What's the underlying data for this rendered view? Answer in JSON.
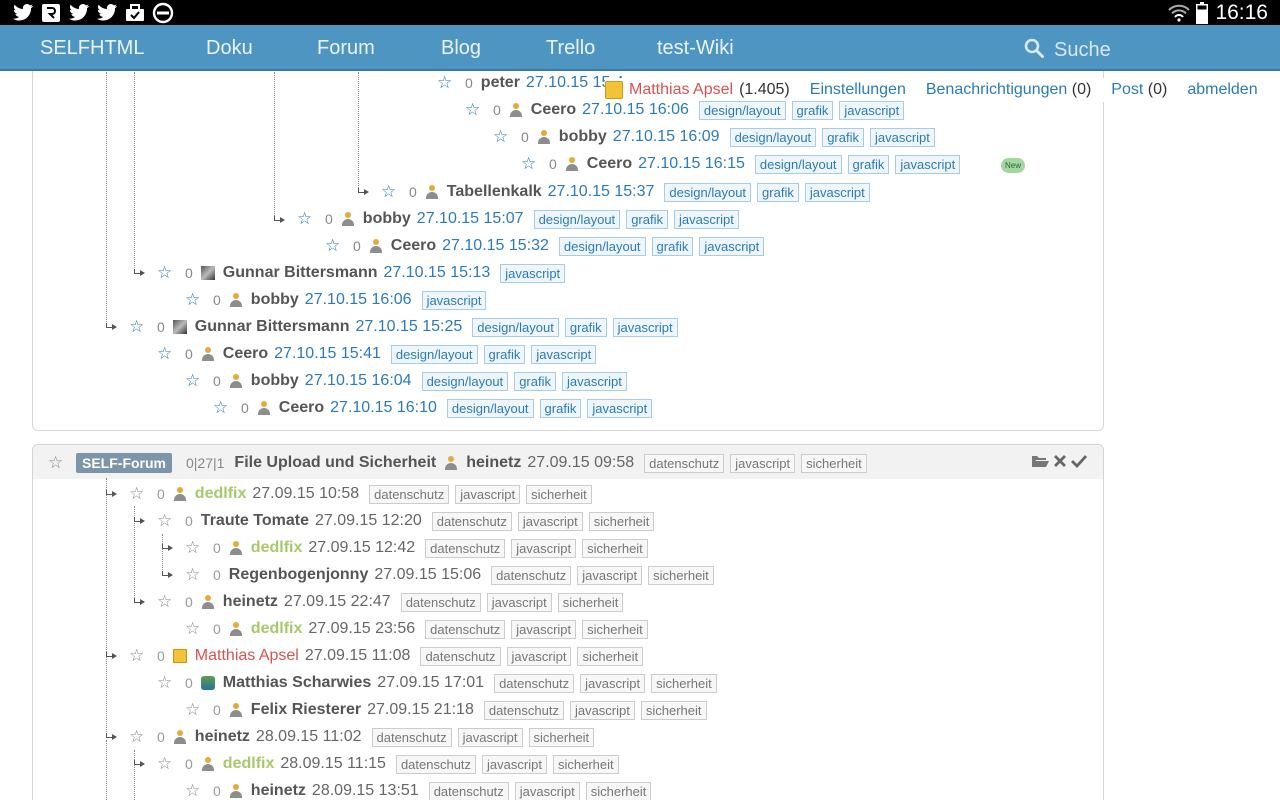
{
  "status_bar": {
    "left_icons": [
      "twitter-icon",
      "app-icon",
      "twitter-icon",
      "twitter-icon",
      "briefcase-icon",
      "blocked-icon"
    ],
    "right_icons": [
      "wifi-icon",
      "battery-icon"
    ],
    "time": "16:16"
  },
  "nav": {
    "items": [
      "SELFHTML",
      "Doku",
      "Forum",
      "Blog",
      "Trello",
      "test-Wiki"
    ],
    "search_label": "Suche"
  },
  "user_bar": {
    "name": "Matthias Apsel",
    "count": "(1.405)",
    "settings": "Einstellungen",
    "notifications": "Benachrichtigungen",
    "notifications_count": "(0)",
    "post": "Post",
    "post_count": "(0)",
    "logout": "abmelden"
  },
  "thread1": [
    {
      "author": "peter",
      "date": "27.10.15 15:4",
      "count": "0",
      "tags": []
    },
    {
      "author": "Ceero",
      "date": "27.10.15 16:06",
      "count": "0",
      "tags": [
        "design/layout",
        "grafik",
        "javascript"
      ]
    },
    {
      "author": "bobby",
      "date": "27.10.15 16:09",
      "count": "0",
      "tags": [
        "design/layout",
        "grafik",
        "javascript"
      ]
    },
    {
      "author": "Ceero",
      "date": "27.10.15 16:15",
      "count": "0",
      "tags": [
        "design/layout",
        "grafik",
        "javascript"
      ],
      "badge": "New"
    },
    {
      "author": "Tabellenkalk",
      "date": "27.10.15 15:37",
      "count": "0",
      "tags": [
        "design/layout",
        "grafik",
        "javascript"
      ]
    },
    {
      "author": "bobby",
      "date": "27.10.15 15:07",
      "count": "0",
      "tags": [
        "design/layout",
        "grafik",
        "javascript"
      ]
    },
    {
      "author": "Ceero",
      "date": "27.10.15 15:32",
      "count": "0",
      "tags": [
        "design/layout",
        "grafik",
        "javascript"
      ]
    },
    {
      "author": "Gunnar Bittersmann",
      "date": "27.10.15 15:13",
      "count": "0",
      "tags": [
        "javascript"
      ]
    },
    {
      "author": "bobby",
      "date": "27.10.15 16:06",
      "count": "0",
      "tags": [
        "javascript"
      ]
    },
    {
      "author": "Gunnar Bittersmann",
      "date": "27.10.15 15:25",
      "count": "0",
      "tags": [
        "design/layout",
        "grafik",
        "javascript"
      ]
    },
    {
      "author": "Ceero",
      "date": "27.10.15 15:41",
      "count": "0",
      "tags": [
        "design/layout",
        "grafik",
        "javascript"
      ]
    },
    {
      "author": "bobby",
      "date": "27.10.15 16:04",
      "count": "0",
      "tags": [
        "design/layout",
        "grafik",
        "javascript"
      ]
    },
    {
      "author": "Ceero",
      "date": "27.10.15 16:10",
      "count": "0",
      "tags": [
        "design/layout",
        "grafik",
        "javascript"
      ]
    }
  ],
  "thread2_header": {
    "forum": "SELF-Forum",
    "counts": "0|27|1",
    "title": "File Upload und Sicherheit",
    "author": "heinetz",
    "date": "27.09.15 09:58",
    "tags": [
      "datenschutz",
      "javascript",
      "sicherheit"
    ],
    "action_icons": [
      "folder-icon",
      "close-icon",
      "check-icon"
    ]
  },
  "thread2": [
    {
      "author": "dedlfix",
      "date": "27.09.15 10:58",
      "count": "0",
      "tags": [
        "datenschutz",
        "javascript",
        "sicherheit"
      ]
    },
    {
      "author": "Traute Tomate",
      "date": "27.09.15 12:20",
      "count": "0",
      "tags": [
        "datenschutz",
        "javascript",
        "sicherheit"
      ]
    },
    {
      "author": "dedlfix",
      "date": "27.09.15 12:42",
      "count": "0",
      "tags": [
        "datenschutz",
        "javascript",
        "sicherheit"
      ]
    },
    {
      "author": "Regenbogenjonny",
      "date": "27.09.15 15:06",
      "count": "0",
      "tags": [
        "datenschutz",
        "javascript",
        "sicherheit"
      ]
    },
    {
      "author": "heinetz",
      "date": "27.09.15 22:47",
      "count": "0",
      "tags": [
        "datenschutz",
        "javascript",
        "sicherheit"
      ]
    },
    {
      "author": "dedlfix",
      "date": "27.09.15 23:56",
      "count": "0",
      "tags": [
        "datenschutz",
        "javascript",
        "sicherheit"
      ]
    },
    {
      "author": "Matthias Apsel",
      "date": "27.09.15 11:08",
      "count": "0",
      "tags": [
        "datenschutz",
        "javascript",
        "sicherheit"
      ]
    },
    {
      "author": "Matthias Scharwies",
      "date": "27.09.15 17:01",
      "count": "0",
      "tags": [
        "datenschutz",
        "javascript",
        "sicherheit"
      ]
    },
    {
      "author": "Felix Riesterer",
      "date": "27.09.15 21:18",
      "count": "0",
      "tags": [
        "datenschutz",
        "javascript",
        "sicherheit"
      ]
    },
    {
      "author": "heinetz",
      "date": "28.09.15 11:02",
      "count": "0",
      "tags": [
        "datenschutz",
        "javascript",
        "sicherheit"
      ]
    },
    {
      "author": "dedlfix",
      "date": "28.09.15 11:15",
      "count": "0",
      "tags": [
        "datenschutz",
        "javascript",
        "sicherheit"
      ]
    },
    {
      "author": "heinetz",
      "date": "28.09.15 13:51",
      "count": "0",
      "tags": [
        "datenschutz",
        "javascript",
        "sicherheit"
      ]
    }
  ]
}
